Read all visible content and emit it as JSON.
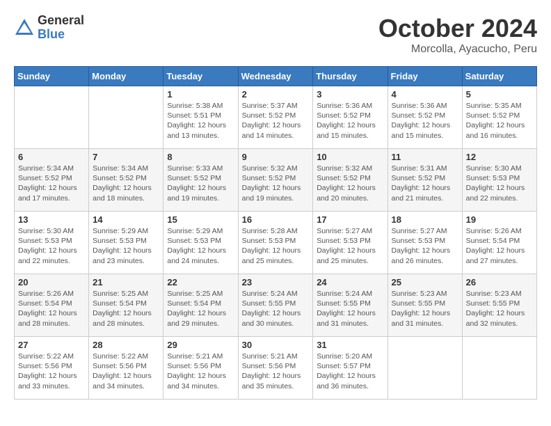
{
  "logo": {
    "general": "General",
    "blue": "Blue"
  },
  "title": "October 2024",
  "subtitle": "Morcolla, Ayacucho, Peru",
  "days_header": [
    "Sunday",
    "Monday",
    "Tuesday",
    "Wednesday",
    "Thursday",
    "Friday",
    "Saturday"
  ],
  "weeks": [
    [
      {
        "day": "",
        "info": ""
      },
      {
        "day": "",
        "info": ""
      },
      {
        "day": "1",
        "info": "Sunrise: 5:38 AM\nSunset: 5:51 PM\nDaylight: 12 hours and 13 minutes."
      },
      {
        "day": "2",
        "info": "Sunrise: 5:37 AM\nSunset: 5:52 PM\nDaylight: 12 hours and 14 minutes."
      },
      {
        "day": "3",
        "info": "Sunrise: 5:36 AM\nSunset: 5:52 PM\nDaylight: 12 hours and 15 minutes."
      },
      {
        "day": "4",
        "info": "Sunrise: 5:36 AM\nSunset: 5:52 PM\nDaylight: 12 hours and 15 minutes."
      },
      {
        "day": "5",
        "info": "Sunrise: 5:35 AM\nSunset: 5:52 PM\nDaylight: 12 hours and 16 minutes."
      }
    ],
    [
      {
        "day": "6",
        "info": "Sunrise: 5:34 AM\nSunset: 5:52 PM\nDaylight: 12 hours and 17 minutes."
      },
      {
        "day": "7",
        "info": "Sunrise: 5:34 AM\nSunset: 5:52 PM\nDaylight: 12 hours and 18 minutes."
      },
      {
        "day": "8",
        "info": "Sunrise: 5:33 AM\nSunset: 5:52 PM\nDaylight: 12 hours and 19 minutes."
      },
      {
        "day": "9",
        "info": "Sunrise: 5:32 AM\nSunset: 5:52 PM\nDaylight: 12 hours and 19 minutes."
      },
      {
        "day": "10",
        "info": "Sunrise: 5:32 AM\nSunset: 5:52 PM\nDaylight: 12 hours and 20 minutes."
      },
      {
        "day": "11",
        "info": "Sunrise: 5:31 AM\nSunset: 5:52 PM\nDaylight: 12 hours and 21 minutes."
      },
      {
        "day": "12",
        "info": "Sunrise: 5:30 AM\nSunset: 5:53 PM\nDaylight: 12 hours and 22 minutes."
      }
    ],
    [
      {
        "day": "13",
        "info": "Sunrise: 5:30 AM\nSunset: 5:53 PM\nDaylight: 12 hours and 22 minutes."
      },
      {
        "day": "14",
        "info": "Sunrise: 5:29 AM\nSunset: 5:53 PM\nDaylight: 12 hours and 23 minutes."
      },
      {
        "day": "15",
        "info": "Sunrise: 5:29 AM\nSunset: 5:53 PM\nDaylight: 12 hours and 24 minutes."
      },
      {
        "day": "16",
        "info": "Sunrise: 5:28 AM\nSunset: 5:53 PM\nDaylight: 12 hours and 25 minutes."
      },
      {
        "day": "17",
        "info": "Sunrise: 5:27 AM\nSunset: 5:53 PM\nDaylight: 12 hours and 25 minutes."
      },
      {
        "day": "18",
        "info": "Sunrise: 5:27 AM\nSunset: 5:53 PM\nDaylight: 12 hours and 26 minutes."
      },
      {
        "day": "19",
        "info": "Sunrise: 5:26 AM\nSunset: 5:54 PM\nDaylight: 12 hours and 27 minutes."
      }
    ],
    [
      {
        "day": "20",
        "info": "Sunrise: 5:26 AM\nSunset: 5:54 PM\nDaylight: 12 hours and 28 minutes."
      },
      {
        "day": "21",
        "info": "Sunrise: 5:25 AM\nSunset: 5:54 PM\nDaylight: 12 hours and 28 minutes."
      },
      {
        "day": "22",
        "info": "Sunrise: 5:25 AM\nSunset: 5:54 PM\nDaylight: 12 hours and 29 minutes."
      },
      {
        "day": "23",
        "info": "Sunrise: 5:24 AM\nSunset: 5:55 PM\nDaylight: 12 hours and 30 minutes."
      },
      {
        "day": "24",
        "info": "Sunrise: 5:24 AM\nSunset: 5:55 PM\nDaylight: 12 hours and 31 minutes."
      },
      {
        "day": "25",
        "info": "Sunrise: 5:23 AM\nSunset: 5:55 PM\nDaylight: 12 hours and 31 minutes."
      },
      {
        "day": "26",
        "info": "Sunrise: 5:23 AM\nSunset: 5:55 PM\nDaylight: 12 hours and 32 minutes."
      }
    ],
    [
      {
        "day": "27",
        "info": "Sunrise: 5:22 AM\nSunset: 5:56 PM\nDaylight: 12 hours and 33 minutes."
      },
      {
        "day": "28",
        "info": "Sunrise: 5:22 AM\nSunset: 5:56 PM\nDaylight: 12 hours and 34 minutes."
      },
      {
        "day": "29",
        "info": "Sunrise: 5:21 AM\nSunset: 5:56 PM\nDaylight: 12 hours and 34 minutes."
      },
      {
        "day": "30",
        "info": "Sunrise: 5:21 AM\nSunset: 5:56 PM\nDaylight: 12 hours and 35 minutes."
      },
      {
        "day": "31",
        "info": "Sunrise: 5:20 AM\nSunset: 5:57 PM\nDaylight: 12 hours and 36 minutes."
      },
      {
        "day": "",
        "info": ""
      },
      {
        "day": "",
        "info": ""
      }
    ]
  ]
}
